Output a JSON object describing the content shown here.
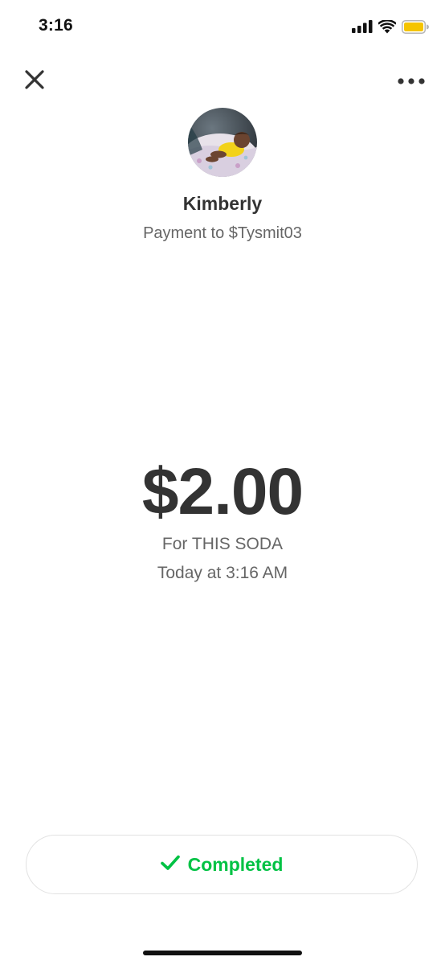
{
  "status_bar": {
    "time": "3:16",
    "icons": [
      "cellular-signal-icon",
      "wifi-icon",
      "battery-icon"
    ],
    "battery_color": "#f5c400"
  },
  "nav": {
    "close_icon": "close-icon",
    "more_icon": "more-options-icon"
  },
  "recipient": {
    "avatar": "avatar-photo",
    "name": "Kimberly",
    "subtitle": "Payment to $Tysmit03"
  },
  "payment": {
    "amount": "$2.00",
    "note": "For THIS SODA",
    "date": "Today at 3:16 AM"
  },
  "status": {
    "icon": "checkmark-icon",
    "label": "Completed",
    "color": "#00c244"
  }
}
